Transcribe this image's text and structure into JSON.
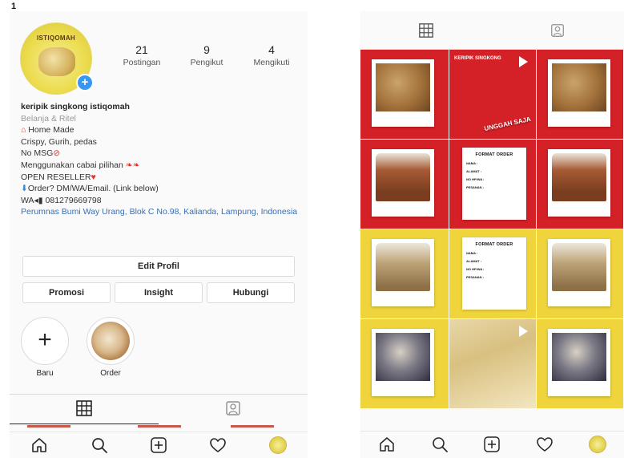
{
  "corner_mark": "1",
  "profile": {
    "avatar_brand": "ISTIQOMAH",
    "stats": [
      {
        "value": "21",
        "label": "Postingan"
      },
      {
        "value": "9",
        "label": "Pengikut"
      },
      {
        "value": "4",
        "label": "Mengikuti"
      }
    ],
    "bio": {
      "name": "keripik singkong istiqomah",
      "category": "Belanja & Ritel",
      "line1_text": "Home Made",
      "line2": "Crispy, Gurih, pedas",
      "line3_text": "No MSG",
      "line4_text": "Menggunakan cabai pilihan",
      "line5_text": "OPEN RESELLER",
      "line6_text": "Order? DM/WA/Email. (Link below)",
      "line7_prefix": "WA",
      "line7_number": "081279669798",
      "location": "Perumnas Bumi Way Urang, Blok C No.98, Kalianda, Lampung, Indonesia"
    },
    "buttons": {
      "edit": "Edit Profil",
      "promo": "Promosi",
      "insight": "Insight",
      "contact": "Hubungi"
    },
    "highlights": [
      {
        "label": "Baru"
      },
      {
        "label": "Order"
      }
    ]
  },
  "icons": {
    "home": "home-icon",
    "search": "search-icon",
    "add": "add-post-icon",
    "activity": "heart-icon",
    "grid": "grid-icon",
    "tagged": "tagged-icon"
  },
  "feed": {
    "posts": [
      {
        "kind": "product",
        "bg": "red",
        "img": "chips"
      },
      {
        "kind": "video",
        "bg": "red",
        "text": "KERIPIK SINGKONG",
        "tag": "UNGGAH SAJA"
      },
      {
        "kind": "product",
        "bg": "red",
        "img": "chips"
      },
      {
        "kind": "product",
        "bg": "red",
        "img": "bag"
      },
      {
        "kind": "order",
        "bg": "red",
        "title": "FORMAT ORDER",
        "fields": [
          "NAMA :",
          "ALAMAT :",
          "NO HP/WA :",
          "PESANAN :"
        ]
      },
      {
        "kind": "product",
        "bg": "red",
        "img": "bag"
      },
      {
        "kind": "product",
        "bg": "yellow",
        "img": "bag-light"
      },
      {
        "kind": "order",
        "bg": "yellow",
        "title": "FORMAT ORDER",
        "fields": [
          "NAMA :",
          "ALAMAT :",
          "NO HP/WA :",
          "PESANAN :"
        ]
      },
      {
        "kind": "product",
        "bg": "yellow",
        "img": "bag-light"
      },
      {
        "kind": "product",
        "bg": "yellow",
        "img": "dark"
      },
      {
        "kind": "video",
        "bg": "yellow",
        "text": "",
        "tag": "",
        "light": true
      },
      {
        "kind": "product",
        "bg": "yellow",
        "img": "dark"
      }
    ]
  },
  "colors": {
    "accent_blue": "#3897f0",
    "post_red": "#d42027",
    "post_yellow": "#efd43c",
    "link": "#3a6fb0"
  }
}
